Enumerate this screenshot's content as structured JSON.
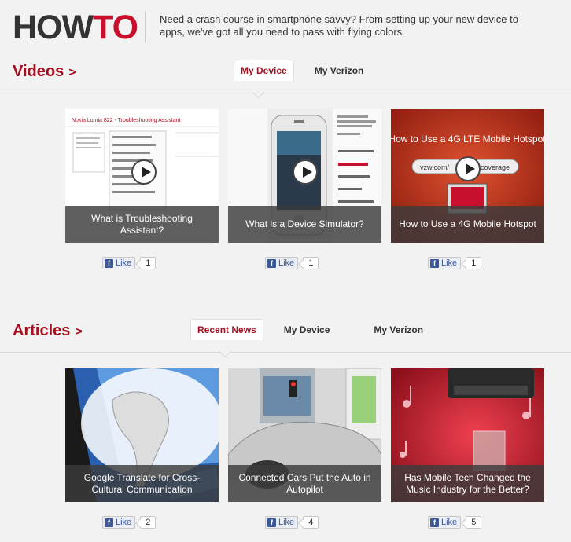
{
  "logo": {
    "part1": "HOW",
    "part2": "TO"
  },
  "tagline": "Need a crash course in smartphone savvy? From setting up your new device to apps, we've got all you need to pass with flying colors.",
  "videos": {
    "title": "Videos",
    "chevron": ">",
    "tabs": [
      {
        "label": "My Device"
      },
      {
        "label": "My Verizon"
      }
    ],
    "cards": [
      {
        "caption": "What is Troubleshooting Assistant?",
        "likes": "1"
      },
      {
        "caption": "What is a Device Simulator?",
        "likes": "1"
      },
      {
        "caption": "How to Use a 4G Mobile Hotspot",
        "likes": "1"
      }
    ],
    "thumb_text": {
      "lumia": "Nokia Lumia 822 - Troubleshooting Assistant",
      "hotspot": "How to Use a 4G LTE Mobile Hotspot",
      "url_left": "vzw.com/",
      "url_right": "coverage"
    }
  },
  "articles": {
    "title": "Articles",
    "chevron": ">",
    "tabs": [
      {
        "label": "Recent News"
      },
      {
        "label": "My Device"
      },
      {
        "label": "My Verizon"
      }
    ],
    "cards": [
      {
        "caption": "Google Translate for Cross-Cultural Communication",
        "likes": "2"
      },
      {
        "caption": "Connected Cars Put the Auto in Autopilot",
        "likes": "4"
      },
      {
        "caption": "Has Mobile Tech Changed the Music Industry for the Better?",
        "likes": "5"
      }
    ]
  },
  "like_label": "Like",
  "fb_glyph": "f",
  "colors": {
    "brand_red": "#c8102e",
    "section_red": "#a50f1f",
    "facebook": "#3b5998"
  }
}
